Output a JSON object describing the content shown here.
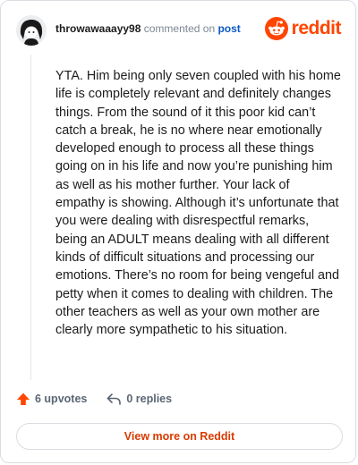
{
  "comment": {
    "username": "throwawaaayy98",
    "action_text": "commented on",
    "post_link": "post",
    "body": "YTA. Him being only seven coupled with his home life is completely relevant and definitely changes things. From the sound of it this poor kid can’t catch a break, he is no where near emotionally developed enough to process all these things going on in his life and now you’re punishing him as well as his mother further. Your lack of empathy is showing. Although it’s unfortunate that you were dealing with disrespectful remarks, being an ADULT means dealing with all different kinds of difficult situations and processing our emotions. There’s no room for being vengeful and petty when it comes to dealing with children. The other teachers as well as your own mother are clearly more sympathetic to his situation."
  },
  "brand": {
    "name": "reddit",
    "icon": "reddit-snoo-icon",
    "color": "#ff4500"
  },
  "actions": {
    "upvotes": "6 upvotes",
    "replies": "0 replies"
  },
  "footer": {
    "view_more": "View more on Reddit"
  },
  "colors": {
    "upvote": "#ff4500",
    "link": "#0b58c6",
    "cta": "#d93a00"
  }
}
